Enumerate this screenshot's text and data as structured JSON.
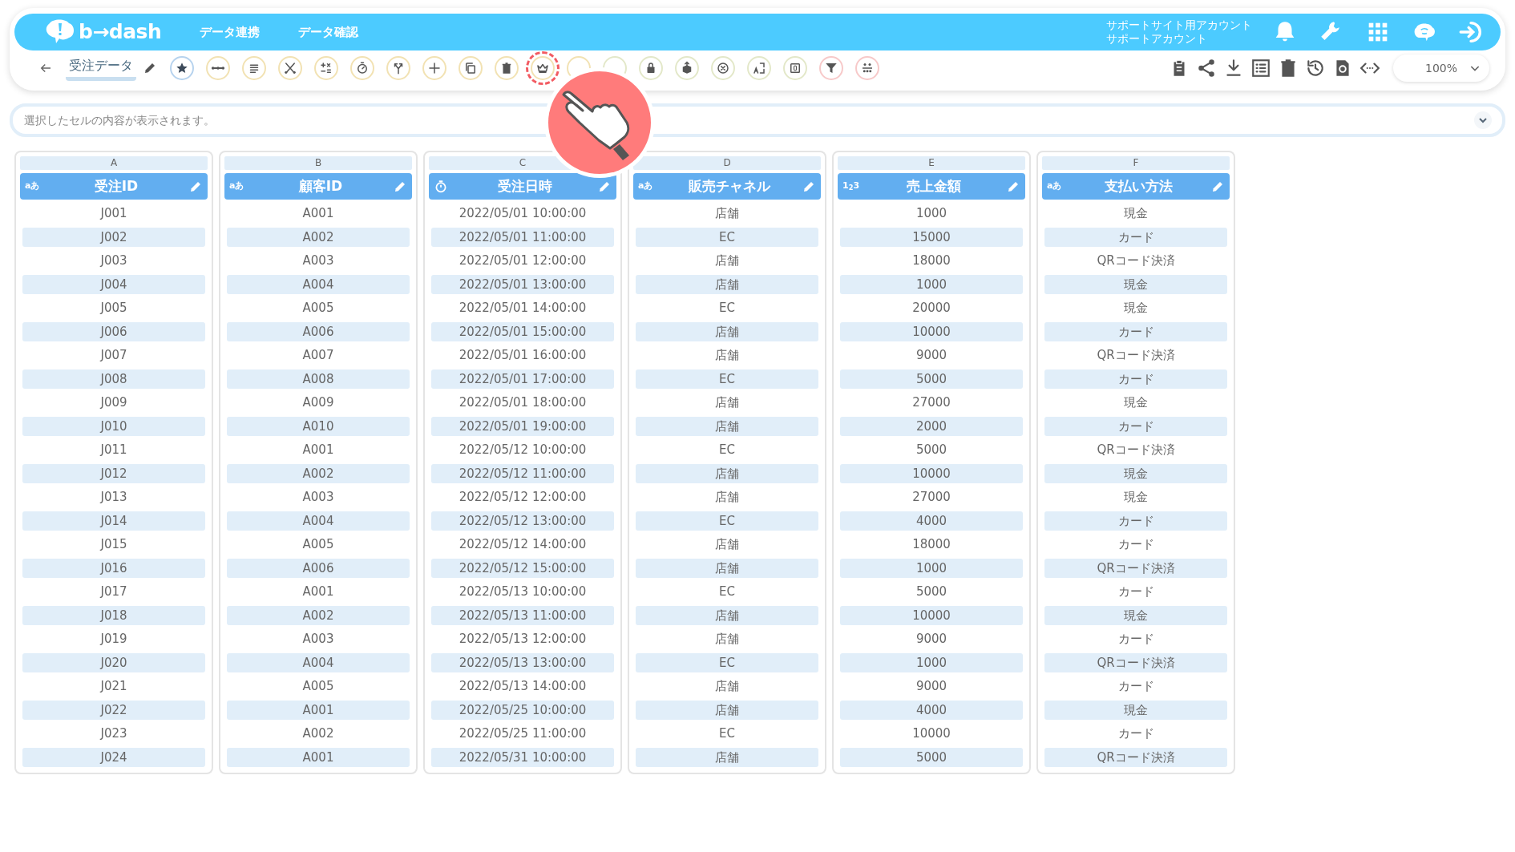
{
  "header": {
    "logo_text": "b→dash",
    "nav": [
      "データ連携",
      "データ確認"
    ],
    "account": [
      "サポートサイト用アカウント",
      "サポートアカウント"
    ]
  },
  "toolbar": {
    "title": "受注データ",
    "zoom": "100%",
    "tools": [
      {
        "kind": "star",
        "color": "#b7d3ee",
        "highlighted": false
      },
      {
        "kind": "dots",
        "color": "#f2e2b3",
        "highlighted": false
      },
      {
        "kind": "lines",
        "color": "#f2e2b3",
        "highlighted": false
      },
      {
        "kind": "scissors",
        "color": "#f2e2b3",
        "highlighted": false
      },
      {
        "kind": "calc",
        "color": "#f2e2b3",
        "highlighted": false
      },
      {
        "kind": "timer",
        "color": "#f2e2b3",
        "highlighted": false
      },
      {
        "kind": "merge",
        "color": "#f2e2b3",
        "highlighted": false
      },
      {
        "kind": "plus",
        "color": "#f2e2b3",
        "highlighted": false
      },
      {
        "kind": "copy",
        "color": "#f2e2b3",
        "highlighted": false
      },
      {
        "kind": "trash",
        "color": "#f2e2b3",
        "highlighted": false
      },
      {
        "kind": "crown",
        "color": "#f2e2b3",
        "highlighted": true
      },
      {
        "kind": "blank",
        "color": "#f2e2b3",
        "highlighted": false
      },
      {
        "kind": "blank",
        "color": "#e3e8c9",
        "highlighted": false
      },
      {
        "kind": "lock",
        "color": "#e3e8c9",
        "highlighted": false
      },
      {
        "kind": "box",
        "color": "#e3e8c9",
        "highlighted": false
      },
      {
        "kind": "xcircle",
        "color": "#e3e8c9",
        "highlighted": false
      },
      {
        "kind": "translate",
        "color": "#e3e8c9",
        "highlighted": false
      },
      {
        "kind": "zero",
        "color": "#e3e8c9",
        "highlighted": false
      },
      {
        "kind": "filter",
        "color": "#f7c9c9",
        "highlighted": false
      },
      {
        "kind": "group",
        "color": "#f7c9c9",
        "highlighted": false
      }
    ]
  },
  "formula_bar": {
    "placeholder": "選択したセルの内容が表示されます。"
  },
  "columns": [
    {
      "letter": "A",
      "title": "受注ID",
      "kind": "text",
      "type_label": "aあ"
    },
    {
      "letter": "B",
      "title": "顧客ID",
      "kind": "text",
      "type_label": "aあ"
    },
    {
      "letter": "C",
      "title": "受注日時",
      "kind": "datetime"
    },
    {
      "letter": "D",
      "title": "販売チャネル",
      "kind": "text",
      "type_label": "aあ"
    },
    {
      "letter": "E",
      "title": "売上金額",
      "kind": "number",
      "type_label": "1$_{2}$3"
    },
    {
      "letter": "F",
      "title": "支払い方法",
      "kind": "text",
      "type_label": "aあ"
    }
  ],
  "rows": [
    [
      "J001",
      "A001",
      "2022/05/01 10:00:00",
      "店舗",
      "1000",
      "現金"
    ],
    [
      "J002",
      "A002",
      "2022/05/01 11:00:00",
      "EC",
      "15000",
      "カード"
    ],
    [
      "J003",
      "A003",
      "2022/05/01 12:00:00",
      "店舗",
      "18000",
      "QRコード決済"
    ],
    [
      "J004",
      "A004",
      "2022/05/01 13:00:00",
      "店舗",
      "1000",
      "現金"
    ],
    [
      "J005",
      "A005",
      "2022/05/01 14:00:00",
      "EC",
      "20000",
      "現金"
    ],
    [
      "J006",
      "A006",
      "2022/05/01 15:00:00",
      "店舗",
      "10000",
      "カード"
    ],
    [
      "J007",
      "A007",
      "2022/05/01 16:00:00",
      "店舗",
      "9000",
      "QRコード決済"
    ],
    [
      "J008",
      "A008",
      "2022/05/01 17:00:00",
      "EC",
      "5000",
      "カード"
    ],
    [
      "J009",
      "A009",
      "2022/05/01 18:00:00",
      "店舗",
      "27000",
      "現金"
    ],
    [
      "J010",
      "A010",
      "2022/05/01 19:00:00",
      "店舗",
      "2000",
      "カード"
    ],
    [
      "J011",
      "A001",
      "2022/05/12 10:00:00",
      "EC",
      "5000",
      "QRコード決済"
    ],
    [
      "J012",
      "A002",
      "2022/05/12 11:00:00",
      "店舗",
      "10000",
      "現金"
    ],
    [
      "J013",
      "A003",
      "2022/05/12 12:00:00",
      "店舗",
      "27000",
      "現金"
    ],
    [
      "J014",
      "A004",
      "2022/05/12 13:00:00",
      "EC",
      "4000",
      "カード"
    ],
    [
      "J015",
      "A005",
      "2022/05/12 14:00:00",
      "店舗",
      "18000",
      "カード"
    ],
    [
      "J016",
      "A006",
      "2022/05/12 15:00:00",
      "店舗",
      "1000",
      "QRコード決済"
    ],
    [
      "J017",
      "A001",
      "2022/05/13 10:00:00",
      "EC",
      "5000",
      "カード"
    ],
    [
      "J018",
      "A002",
      "2022/05/13 11:00:00",
      "店舗",
      "10000",
      "現金"
    ],
    [
      "J019",
      "A003",
      "2022/05/13 12:00:00",
      "店舗",
      "9000",
      "カード"
    ],
    [
      "J020",
      "A004",
      "2022/05/13 13:00:00",
      "EC",
      "1000",
      "QRコード決済"
    ],
    [
      "J021",
      "A005",
      "2022/05/13 14:00:00",
      "店舗",
      "9000",
      "カード"
    ],
    [
      "J022",
      "A001",
      "2022/05/25 10:00:00",
      "店舗",
      "4000",
      "現金"
    ],
    [
      "J023",
      "A002",
      "2022/05/25 11:00:00",
      "EC",
      "10000",
      "カード"
    ],
    [
      "J024",
      "A001",
      "2022/05/31 10:00:00",
      "店舗",
      "5000",
      "QRコード決済"
    ]
  ]
}
